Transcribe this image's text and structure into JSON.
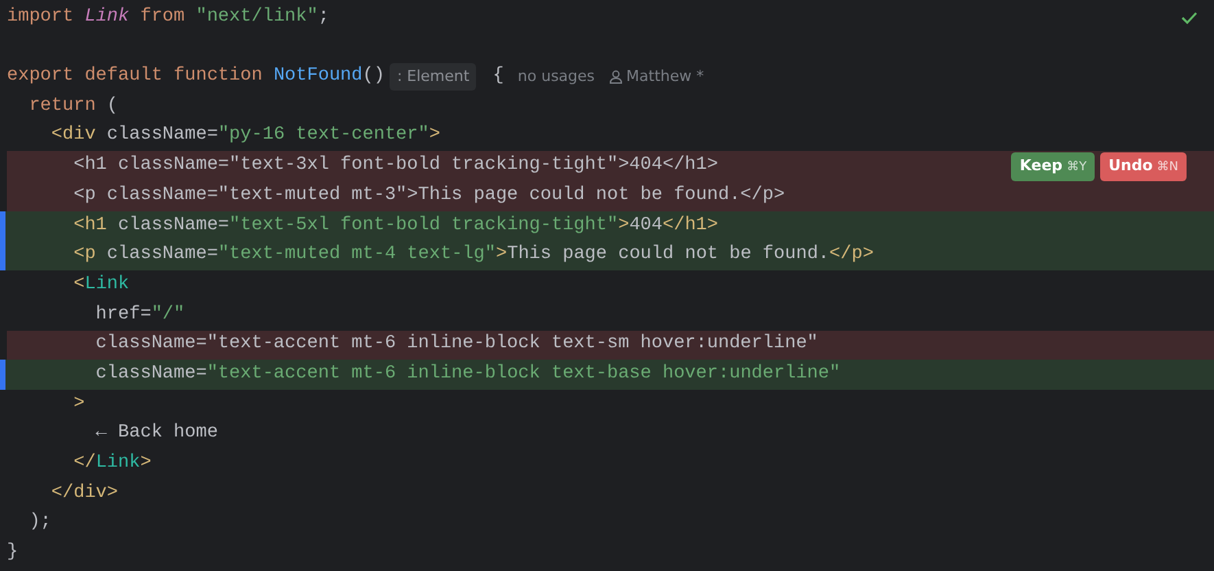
{
  "status": {
    "ok": true
  },
  "lines": [
    {
      "added": false,
      "removed": false,
      "tokens": [
        {
          "kind": "keyword",
          "text": "import "
        },
        {
          "kind": "component_italic",
          "text": "Link"
        },
        {
          "kind": "keyword",
          "text": " from "
        },
        {
          "kind": "string",
          "text": "\"next/link\""
        },
        {
          "kind": "plain",
          "text": ";"
        }
      ]
    },
    {
      "added": false,
      "removed": false
    },
    {
      "added": false,
      "removed": false,
      "tokens": [
        {
          "kind": "keyword",
          "text": "export default function "
        },
        {
          "kind": "function",
          "text": "NotFound"
        },
        {
          "kind": "plain",
          "text": "()"
        },
        {
          "kind": "chip",
          "text": ": Element"
        },
        {
          "kind": "plain",
          "text": " {"
        },
        {
          "kind": "hint",
          "text": "no usages"
        },
        {
          "kind": "author",
          "text": "Matthew *"
        }
      ]
    },
    {
      "added": false,
      "removed": false,
      "tokens": [
        {
          "kind": "keyword",
          "text": "  return "
        },
        {
          "kind": "plain",
          "text": "("
        }
      ]
    },
    {
      "added": false,
      "removed": false,
      "tokens": [
        {
          "kind": "tag",
          "text": "    <div "
        },
        {
          "kind": "plain",
          "text": "className="
        },
        {
          "kind": "string",
          "text": "\"py-16 text-center\""
        },
        {
          "kind": "tag",
          "text": ">"
        }
      ]
    },
    {
      "added": false,
      "removed": true,
      "tokens": [
        {
          "kind": "plain",
          "text": "      <h1 className=\"text-3xl font-bold tracking-tight\">404</h1>"
        }
      ],
      "actions": [
        {
          "kind": "keep",
          "label": "Keep",
          "shortcut": "⌘Y"
        },
        {
          "kind": "undo",
          "label": "Undo",
          "shortcut": "⌘N"
        }
      ]
    },
    {
      "added": false,
      "removed": true,
      "tokens": [
        {
          "kind": "plain",
          "text": "      <p className=\"text-muted mt-3\">This page could not be found.</p>"
        }
      ]
    },
    {
      "added": true,
      "removed": false,
      "tokens": [
        {
          "kind": "tag",
          "text": "      <h1 "
        },
        {
          "kind": "plain",
          "text": "className="
        },
        {
          "kind": "string",
          "text": "\"text-5xl font-bold tracking-tight\""
        },
        {
          "kind": "tag",
          "text": ">"
        },
        {
          "kind": "plain",
          "text": "404"
        },
        {
          "kind": "tag",
          "text": "</h1>"
        }
      ]
    },
    {
      "added": true,
      "removed": false,
      "tokens": [
        {
          "kind": "tag",
          "text": "      <p "
        },
        {
          "kind": "plain",
          "text": "className="
        },
        {
          "kind": "string",
          "text": "\"text-muted mt-4 text-lg\""
        },
        {
          "kind": "tag",
          "text": ">"
        },
        {
          "kind": "plain",
          "text": "This page could not be found."
        },
        {
          "kind": "tag",
          "text": "</p>"
        }
      ]
    },
    {
      "added": false,
      "removed": false,
      "tokens": [
        {
          "kind": "tag",
          "text": "      <"
        },
        {
          "kind": "component",
          "text": "Link"
        }
      ]
    },
    {
      "added": false,
      "removed": false,
      "tokens": [
        {
          "kind": "plain",
          "text": "        href="
        },
        {
          "kind": "string",
          "text": "\"/\""
        }
      ]
    },
    {
      "added": false,
      "removed": true,
      "tokens": [
        {
          "kind": "plain",
          "text": "        className=\"text-accent mt-6 inline-block text-sm hover:underline\""
        }
      ]
    },
    {
      "added": true,
      "removed": false,
      "tokens": [
        {
          "kind": "plain",
          "text": "        className="
        },
        {
          "kind": "string",
          "text": "\"text-accent mt-6 inline-block text-base hover:underline\""
        }
      ]
    },
    {
      "added": false,
      "removed": false,
      "tokens": [
        {
          "kind": "tag",
          "text": "      >"
        }
      ]
    },
    {
      "added": false,
      "removed": false,
      "tokens": [
        {
          "kind": "plain",
          "text": "        ← Back home"
        }
      ]
    },
    {
      "added": false,
      "removed": false,
      "tokens": [
        {
          "kind": "tag",
          "text": "      </"
        },
        {
          "kind": "component",
          "text": "Link"
        },
        {
          "kind": "tag",
          "text": ">"
        }
      ]
    },
    {
      "added": false,
      "removed": false,
      "tokens": [
        {
          "kind": "tag",
          "text": "    </div>"
        }
      ]
    },
    {
      "added": false,
      "removed": false,
      "tokens": [
        {
          "kind": "plain",
          "text": "  );"
        }
      ]
    },
    {
      "added": false,
      "removed": false,
      "tokens": [
        {
          "kind": "plain",
          "text": "}"
        }
      ]
    }
  ]
}
